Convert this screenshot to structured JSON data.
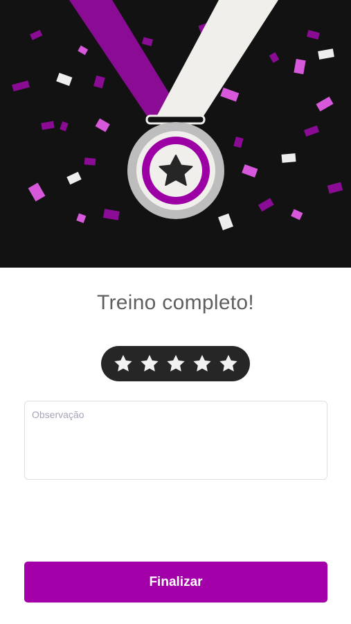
{
  "hero": {
    "illustration": "medal-with-ribbon-and-confetti",
    "colors": {
      "background": "#121212",
      "ribbon_purple": "#8a0c94",
      "ribbon_white": "#f1efec",
      "medal_ring": "#bdbdbd",
      "medal_inner": "#9c00a5",
      "star": "#262626",
      "confetti_purple": "#8a0c94",
      "confetti_magenta": "#d858dc",
      "confetti_white": "#eeeeee"
    }
  },
  "title": "Treino completo!",
  "rating": {
    "max": 5,
    "value": 5,
    "star_color": "#f2f2f2",
    "pill_color": "#262626"
  },
  "note": {
    "placeholder": "Observação",
    "value": ""
  },
  "finish_button": {
    "label": "Finalizar",
    "color": "#a400a9"
  }
}
